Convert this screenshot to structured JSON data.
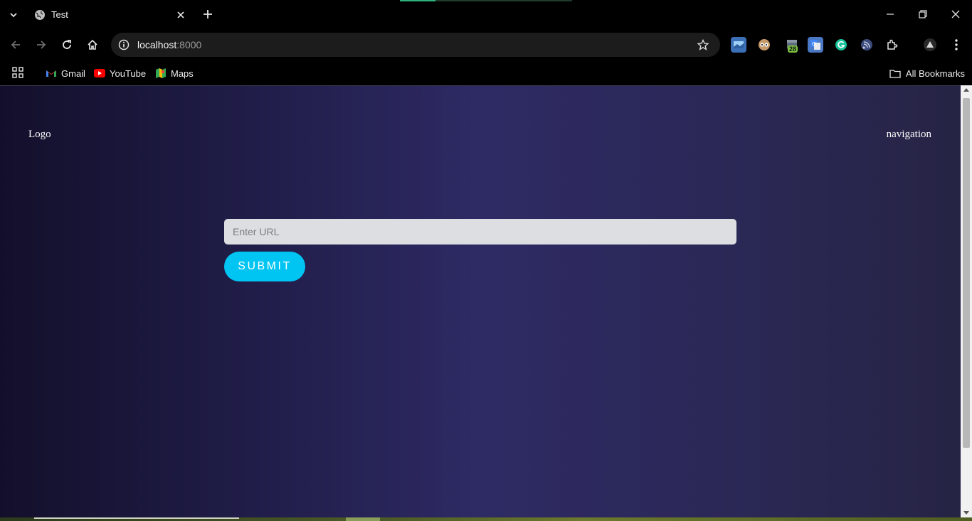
{
  "browser": {
    "tab": {
      "title": "Test"
    },
    "omnibox": {
      "host": "localhost",
      "port": ":8000"
    },
    "extensions": {
      "badge_count": "28"
    },
    "bookmarks": [
      {
        "label": "Gmail"
      },
      {
        "label": "YouTube"
      },
      {
        "label": "Maps"
      }
    ],
    "all_bookmarks_label": "All Bookmarks"
  },
  "page": {
    "logo_text": "Logo",
    "nav_text": "navigation",
    "url_input": {
      "placeholder": "Enter URL",
      "value": ""
    },
    "submit_label": "SUBMIT"
  },
  "colors": {
    "submit_button": "#00c4f2",
    "page_gradient_left": "#130f2b",
    "page_gradient_mid": "#2e2a64",
    "page_gradient_right": "#262444"
  }
}
